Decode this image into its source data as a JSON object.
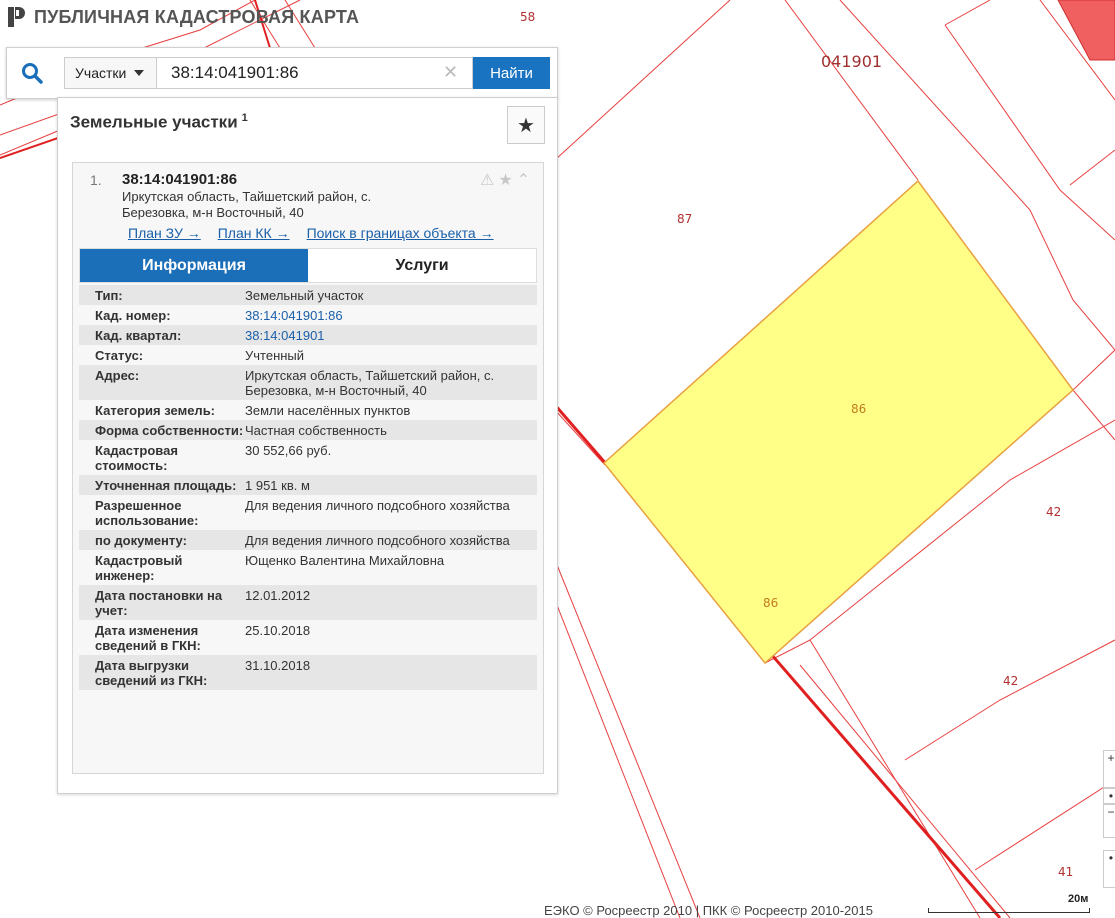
{
  "header": {
    "title": "ПУБЛИЧНАЯ КАДАСТРОВАЯ КАРТА"
  },
  "search": {
    "type_label": "Участки",
    "query": "38:14:041901:86",
    "clear_glyph": "✕",
    "find_label": "Найти"
  },
  "panel": {
    "title": "Земельные участки",
    "count": "1"
  },
  "result": {
    "number": "1.",
    "cad_number": "38:14:041901:86",
    "address": "Иркутская область, Тайшетский район, с. Березовка, м-н Восточный, 40",
    "links": [
      "План ЗУ →",
      "План КК →",
      "Поиск в границах объекта →"
    ]
  },
  "tabs": [
    "Информация",
    "Услуги"
  ],
  "info": [
    {
      "key": "Тип:",
      "value": "Земельный участок"
    },
    {
      "key": "Кад. номер:",
      "value": "38:14:041901:86"
    },
    {
      "key": "Кад. квартал:",
      "value": "38:14:041901"
    },
    {
      "key": "Статус:",
      "value": "Учтенный"
    },
    {
      "key": "Адрес:",
      "value": "Иркутская область, Тайшетский район, с. Березовка, м-н Восточный, 40"
    },
    {
      "key": "Категория земель:",
      "value": "Земли населённых пунктов"
    },
    {
      "key": "Форма собственности:",
      "value": "Частная собственность"
    },
    {
      "key": "Кадастровая стоимость:",
      "value": "30 552,66 руб."
    },
    {
      "key": "Уточненная площадь:",
      "value": "1 951 кв. м"
    },
    {
      "key": "Разрешенное использование:",
      "value": "Для ведения личного подсобного хозяйства"
    },
    {
      "key": "по документу:",
      "value": "Для ведения личного подсобного хозяйства"
    },
    {
      "key": "Кадастровый инженер:",
      "value": "Ющенко Валентина Михайловна"
    },
    {
      "key": "Дата постановки на учет:",
      "value": "12.01.2012"
    },
    {
      "key": "Дата изменения сведений в ГКН:",
      "value": "25.10.2018"
    },
    {
      "key": "Дата выгрузки сведений из ГКН:",
      "value": "31.10.2018"
    }
  ],
  "map": {
    "labels": [
      "58",
      "041901",
      "87",
      "86",
      "86",
      "42",
      "42",
      "41"
    ],
    "parcel_fill": "#ffff88",
    "parcel_stroke": "#e8a040",
    "boundary_color": "#e03030"
  },
  "footer": {
    "attribution": "ЕЭКО © Росреестр 2010 | ПКК © Росреестр 2010-2015",
    "scale": "20м"
  }
}
